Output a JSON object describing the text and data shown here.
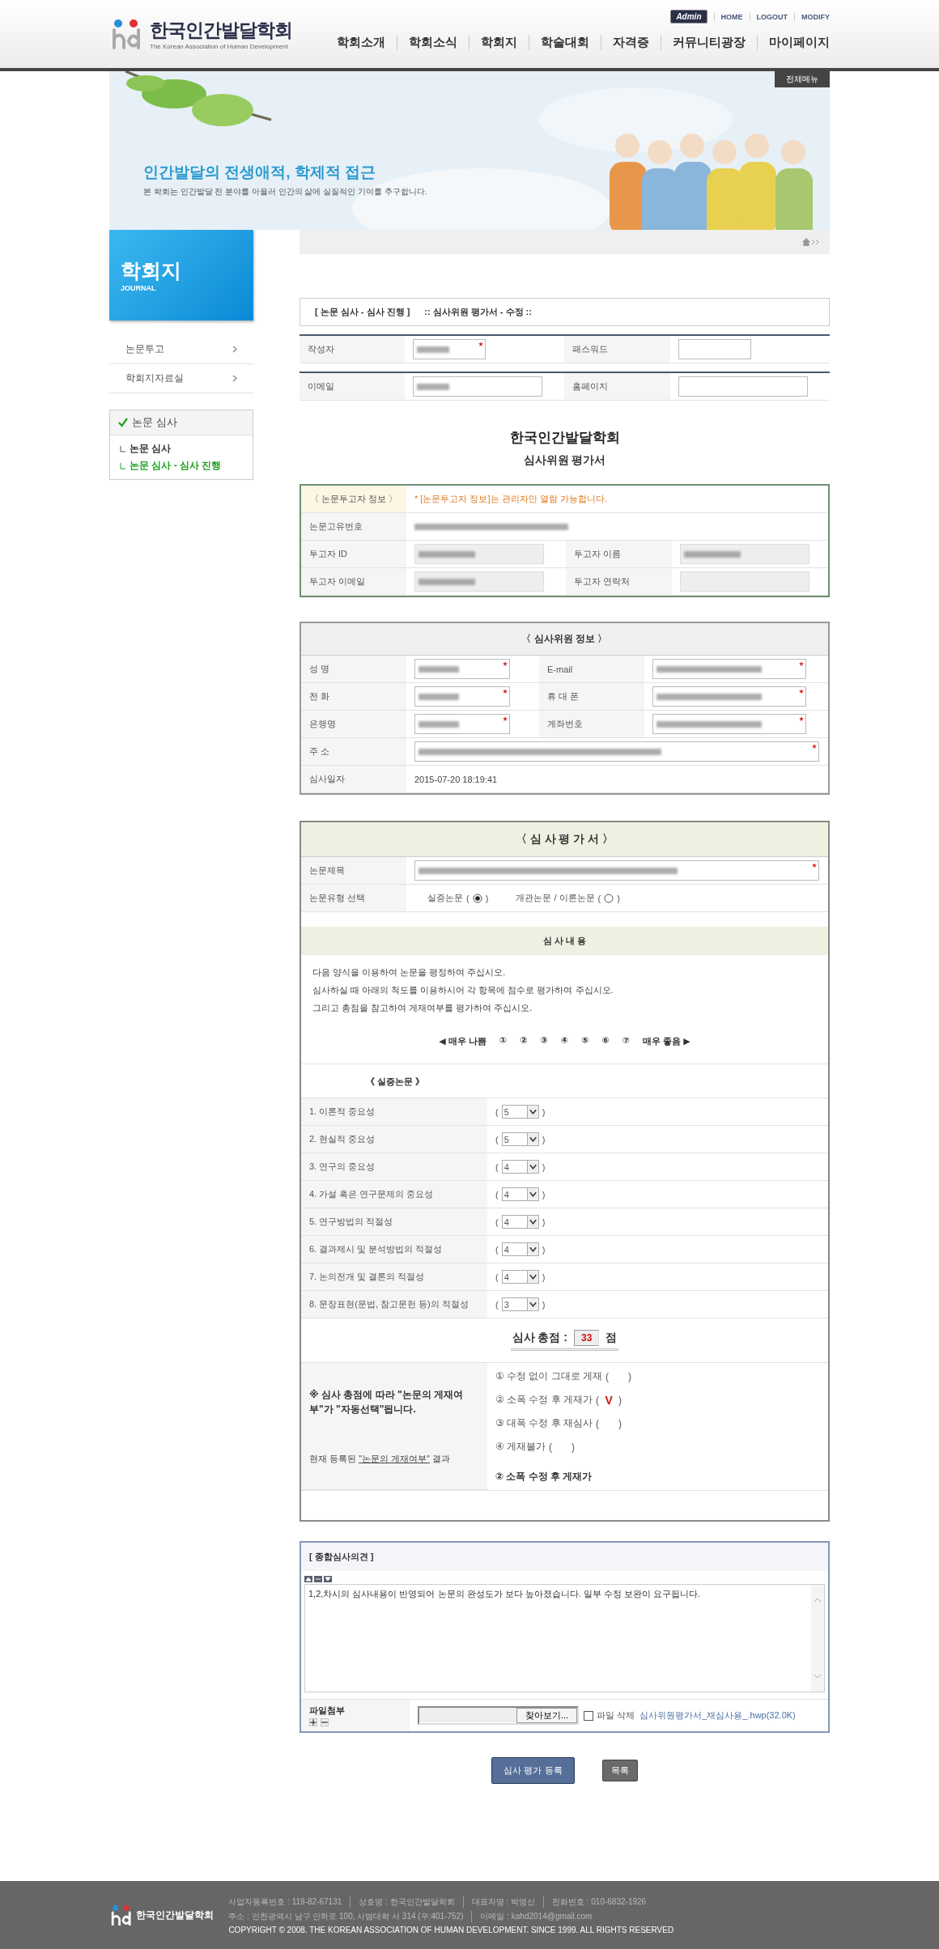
{
  "header": {
    "logo_text": "한국인간발달학회",
    "logo_sub": "The Korean Association of Human Development",
    "admin_badge": "Admin",
    "util_links": [
      "HOME",
      "LOGOUT",
      "MODIFY"
    ],
    "nav": [
      "학회소개",
      "학회소식",
      "학회지",
      "학술대회",
      "자격증",
      "커뮤니티광장",
      "마이페이지"
    ]
  },
  "banner": {
    "all_menu": "전체메뉴",
    "headline": "인간발달의 전생애적, 학제적 접근",
    "subline": "본 학회는 인간발달 전 분야를 아울러 인간의 삶에 실질적인 기여를 추구합니다."
  },
  "sidebar": {
    "title": "학회지",
    "subtitle": "JOURNAL",
    "menu": [
      "논문투고",
      "학회지자료실"
    ],
    "submenu": {
      "title": "논문 심사",
      "items": [
        {
          "label": "논문 심사",
          "selected": false
        },
        {
          "label": "논문 심사 - 심사 진행",
          "selected": true
        }
      ]
    }
  },
  "page_title": {
    "section": "[ 논문 심사 - 심사 진행 ]",
    "subtitle": ":: 심사위원 평가서 - 수정 ::"
  },
  "author_rows": [
    [
      {
        "label": "작성자",
        "redacted": true,
        "required": true
      },
      {
        "label": "패스워드",
        "redacted": false,
        "required": false
      }
    ],
    [
      {
        "label": "이메일",
        "redacted": true,
        "required": false
      },
      {
        "label": "홈페이지",
        "redacted": false,
        "required": false
      }
    ]
  ],
  "form_title": "한국인간발달학회",
  "form_subtitle": "심사위원 평가서",
  "submitter": {
    "title": "〈 논문투고자 정보 〉",
    "notice": "* [논문투고자 정보]는 관리자만 열람 가능합니다.",
    "rows": [
      [
        {
          "label": "논문고유번호",
          "kind": "text",
          "redacted": true
        }
      ],
      [
        {
          "label": "투고자 ID",
          "kind": "readonly",
          "redacted": true
        },
        {
          "label": "투고자 이름",
          "kind": "readonly",
          "redacted": true
        }
      ],
      [
        {
          "label": "투고자 이메일",
          "kind": "readonly",
          "redacted": true
        },
        {
          "label": "투고자 연락처",
          "kind": "readonly",
          "redacted": false
        }
      ]
    ]
  },
  "reviewer": {
    "title": "〈 심사위원 정보 〉",
    "rows": [
      [
        {
          "label": "성 명",
          "kind": "input",
          "redacted": true,
          "required": true
        },
        {
          "label": "E-mail",
          "kind": "input",
          "redacted": true,
          "required": true
        }
      ],
      [
        {
          "label": "전 화",
          "kind": "input",
          "redacted": true,
          "required": true
        },
        {
          "label": "휴 대 폰",
          "kind": "input",
          "redacted": true,
          "required": true
        }
      ],
      [
        {
          "label": "은행명",
          "kind": "input",
          "redacted": true,
          "required": true
        },
        {
          "label": "계좌번호",
          "kind": "input",
          "redacted": true,
          "required": true
        }
      ],
      [
        {
          "label": "주 소",
          "kind": "wide",
          "redacted": true,
          "required": true
        }
      ],
      [
        {
          "label": "심사일자",
          "kind": "text",
          "value": "2015-07-20 18:19:41"
        }
      ]
    ]
  },
  "evaluation": {
    "title": "〈 심 사 평 가 서 〉",
    "paper_title": {
      "label": "논문제목",
      "redacted": true,
      "required": true
    },
    "paper_type": {
      "label": "논문유형 선택",
      "options": [
        {
          "label": "실증논문",
          "open": "(",
          "close": ")",
          "selected": true
        },
        {
          "label": "개관논문 / 이론논문",
          "open": "(",
          "close": ")",
          "selected": false
        }
      ]
    },
    "content_title": "심 사 내 용",
    "instructions": [
      "다음 양식을 이용하여 논문을 평정하여 주십시오.",
      "심사하실 때 아래의 척도를 이용하시어 각 항목에 점수로 평가하여 주십시오.",
      "그리고 총점을 참고하여 게재여부를 평가하여 주십시오."
    ],
    "scale": {
      "low": "◀ 매우 나쁨",
      "points": [
        "①",
        "②",
        "③",
        "④",
        "⑤",
        "⑥",
        "⑦"
      ],
      "high": "매우 좋음 ▶"
    },
    "section": "《 실증논문 》",
    "criteria": [
      {
        "label": "1. 이론적 중요성",
        "score": "5",
        "open": "(",
        "close": ")"
      },
      {
        "label": "2. 현실적 중요성",
        "score": "5",
        "open": "(",
        "close": ")"
      },
      {
        "label": "3. 연구의 중요성",
        "score": "4",
        "open": "(",
        "close": ")"
      },
      {
        "label": "4. 가설 혹은 연구문제의 중요성",
        "score": "4",
        "open": "(",
        "close": ")"
      },
      {
        "label": "5. 연구방법의 적절성",
        "score": "4",
        "open": "(",
        "close": ")"
      },
      {
        "label": "6. 결과제시 및 분석방법의 적절성",
        "score": "4",
        "open": "(",
        "close": ")"
      },
      {
        "label": "7. 논의전개 및 결론의 적절성",
        "score": "4",
        "open": "(",
        "close": ")"
      },
      {
        "label": "8. 문장표현(문법, 참고문헌 등)의 적절성",
        "score": "3",
        "open": "(",
        "close": ")"
      }
    ],
    "total": {
      "label": "심사 총점 :",
      "value": "33",
      "unit": "점"
    },
    "publication": {
      "note": "※ 심사 총점에 따라 \"논문의 게재여부\"가 \"자동선택\"됩니다.",
      "check_mark": "V",
      "options": [
        {
          "label": "① 수정 없이 그대로 게재",
          "open": "(",
          "close": ")",
          "selected": false
        },
        {
          "label": "② 소폭 수정 후 게재가",
          "open": "(",
          "close": ")",
          "selected": true
        },
        {
          "label": "③ 대폭 수정 후 재심사",
          "open": "(",
          "close": ")",
          "selected": false
        },
        {
          "label": "④ 게재불가",
          "open": "(",
          "close": ")",
          "selected": false
        }
      ],
      "current_prefix": "현재 등록된",
      "current_link": "\"논문의 게재여부\"",
      "current_suffix": "결과",
      "current_value": "② 소폭 수정 후 게재가"
    }
  },
  "opinion": {
    "title": "[ 종합심사의견 ]",
    "text": "1,2,차시의 심사내용이 반영되어 논문의 완성도가 보다 높아졌습니다. 일부 수정 보완이 요구됩니다.",
    "attach_label": "파일첨부",
    "browse": "찾아보기...",
    "delete_label": "파일 삭제",
    "delete_checked": false,
    "file_link": "심사위원평가서_재심사용_.hwp(32.0K)"
  },
  "buttons": [
    {
      "label": "심사 평가 등록",
      "kind": "primary"
    },
    {
      "label": "목록",
      "kind": "secondary"
    }
  ],
  "footer": {
    "logo_text": "한국인간발달학회",
    "lines": [
      [
        "사업자등록번호 : 119-82-67131",
        "상호명 : 한국인간발달학회",
        "대표자명 : 박영신",
        "전화번호 : 010-6832-1926"
      ],
      [
        "주소 : 인천광역시 남구 인하로 100, 사범대학 서 314 (우:401-752)",
        "이메일 : kahd2014@gmail.com"
      ],
      [
        "COPYRIGHT © 2008. THE KOREAN ASSOCIATION OF HUMAN DEVELOPMENT. SINCE 1999. ALL RIGHTS RESERVED"
      ]
    ]
  }
}
